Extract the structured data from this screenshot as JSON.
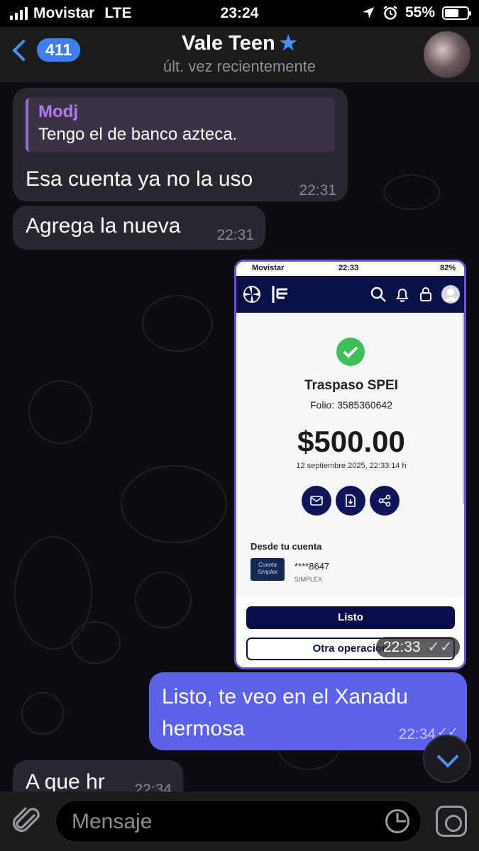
{
  "status_bar": {
    "carrier": "Movistar",
    "network": "LTE",
    "time": "23:24",
    "battery": "55%",
    "battery_level": 0.55
  },
  "header": {
    "back_count": "411",
    "contact_name": "Vale Teen",
    "last_seen": "últ. vez recientemente"
  },
  "messages": [
    {
      "reply_to_author": "Modj",
      "reply_to_text": "Tengo el de banco azteca.",
      "text": "Esa cuenta ya no la uso",
      "time": "22:31"
    },
    {
      "text": "Agrega la nueva",
      "time": "22:31"
    },
    {
      "image_time": "22:33"
    },
    {
      "text": "Listo, te veo en el Xanadu hermosa",
      "time": "22:34"
    },
    {
      "text": "A que hr",
      "time": "22:34"
    }
  ],
  "receipt": {
    "status_carrier": "Movistar",
    "status_time": "22:33",
    "status_battery": "82%",
    "title": "Traspaso SPEI",
    "folio": "Folio: 3585360642",
    "amount": "$500.00",
    "date": "12 septiembre 2025, 22:33:14 h",
    "from_label": "Desde tu cuenta",
    "card_logo_text": "Cuenta Simplex",
    "account": "****8647",
    "account_name": "SIMPLEX",
    "done_button": "Listo",
    "other_button": "Otra operacion"
  },
  "input": {
    "placeholder": "Mensaje"
  },
  "colors": {
    "accent": "#4b8ef5",
    "outgoing_bubble": "#5b61e8",
    "incoming_bubble": "#2a2731",
    "reply_author": "#b57bf0",
    "receipt_navy": "#0b1046",
    "check_green": "#3fbf5a"
  }
}
